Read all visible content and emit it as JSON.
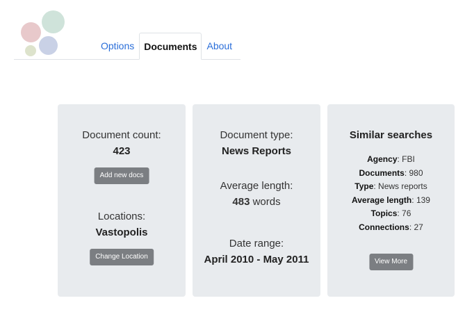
{
  "tabs": [
    {
      "label": "Options"
    },
    {
      "label": "Documents"
    },
    {
      "label": "About"
    }
  ],
  "active_tab": "Documents",
  "card_counts": {
    "count_label": "Document count:",
    "count_value": "423",
    "add_button": "Add new docs",
    "locations_label": "Locations:",
    "locations_value": "Vastopolis",
    "change_button": "Change Location"
  },
  "card_type": {
    "type_label": "Document type:",
    "type_value": "News Reports",
    "avg_label": "Average length:",
    "avg_value": "483",
    "avg_unit": "words",
    "date_label": "Date range:",
    "date_value": "April 2010 - May 2011"
  },
  "card_similar": {
    "title": "Similar searches",
    "stats": [
      {
        "key": "Agency",
        "value": "FBI"
      },
      {
        "key": "Documents",
        "value": "980"
      },
      {
        "key": "Type",
        "value": "News reports"
      },
      {
        "key": "Average length",
        "value": "139"
      },
      {
        "key": "Topics",
        "value": "76"
      },
      {
        "key": "Connections",
        "value": "27"
      }
    ],
    "view_button": "View More"
  }
}
